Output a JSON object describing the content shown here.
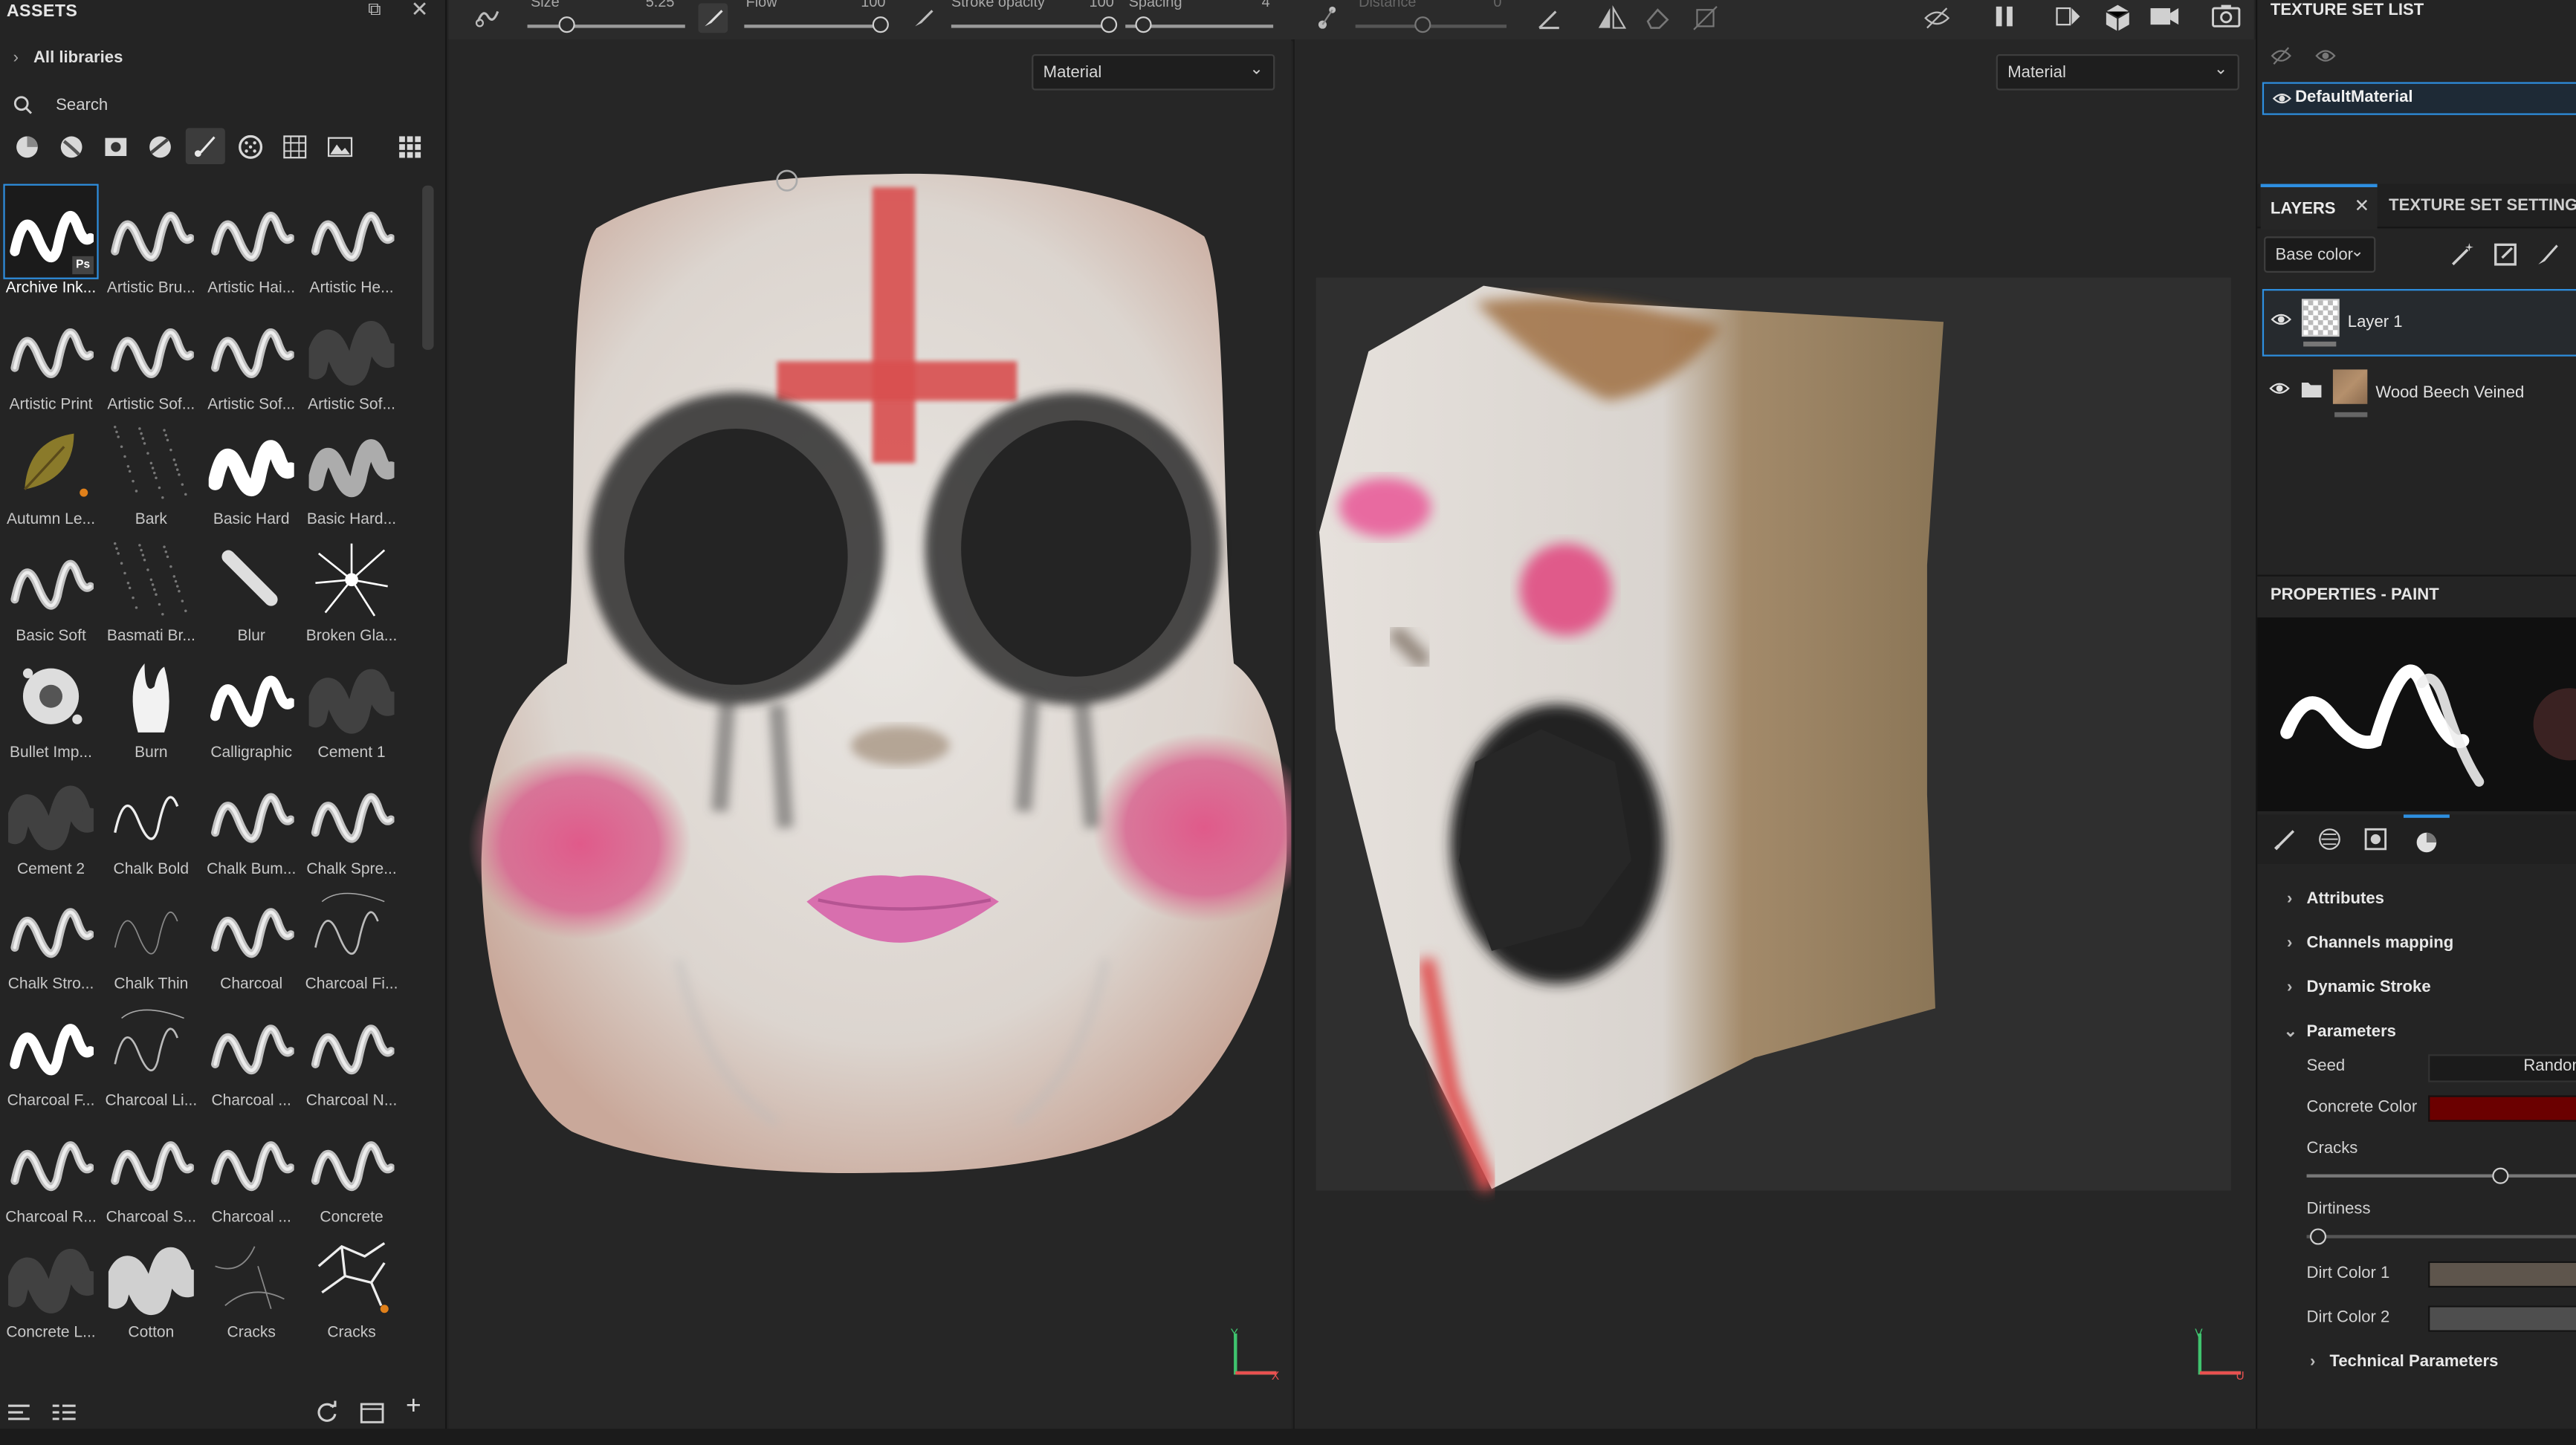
{
  "assets": {
    "title": "ASSETS",
    "breadcrumb": "All libraries",
    "search_placeholder": "Search",
    "brushes": [
      "Archive Ink...",
      "Artistic Bru...",
      "Artistic Hai...",
      "Artistic He...",
      "Artistic Print",
      "Artistic Sof...",
      "Artistic Sof...",
      "Artistic Sof...",
      "Autumn Le...",
      "Bark",
      "Basic Hard",
      "Basic Hard...",
      "Basic Soft",
      "Basmati Br...",
      "Blur",
      "Broken Gla...",
      "Bullet Imp...",
      "Burn",
      "Calligraphic",
      "Cement 1",
      "Cement 2",
      "Chalk Bold",
      "Chalk Bum...",
      "Chalk Spre...",
      "Chalk Stro...",
      "Chalk Thin",
      "Charcoal",
      "Charcoal Fi...",
      "Charcoal F...",
      "Charcoal Li...",
      "Charcoal ...",
      "Charcoal N...",
      "Charcoal R...",
      "Charcoal S...",
      "Charcoal ...",
      "Concrete",
      "Concrete L...",
      "Cotton",
      "Cracks",
      "Cracks"
    ]
  },
  "toolbar": {
    "size_label": "Size",
    "size_value": "5.25",
    "flow_label": "Flow",
    "flow_value": "100",
    "stroke_opacity_label": "Stroke opacity",
    "stroke_opacity_value": "100",
    "spacing_label": "Spacing",
    "spacing_value": "4",
    "distance_label": "Distance",
    "distance_value": "0"
  },
  "viewports": {
    "left_mode": "Material",
    "right_mode": "Material",
    "axis_3d": {
      "up": "Y",
      "right": "X"
    },
    "axis_2d": {
      "up": "V",
      "right": "U"
    }
  },
  "texture_set_list": {
    "title": "TEXTURE SET LIST",
    "items": [
      "DefaultMaterial"
    ]
  },
  "layers": {
    "tab_layers": "LAYERS",
    "tab_texture_settings": "TEXTURE SET SETTING",
    "channel": "Base color",
    "items": [
      {
        "name": "Layer 1"
      },
      {
        "name": "Wood Beech Veined"
      }
    ]
  },
  "properties": {
    "title": "PROPERTIES - PAINT",
    "sections": [
      "Attributes",
      "Channels mapping",
      "Dynamic Stroke",
      "Parameters"
    ],
    "seed_label": "Seed",
    "seed_button": "Random",
    "concrete_color_label": "Concrete Color",
    "concrete_color": "#6b0000",
    "cracks_label": "Cracks",
    "cracks_value": 0.75,
    "dirtiness_label": "Dirtiness",
    "dirtiness_value": 0.0,
    "dirt_color_1_label": "Dirt Color 1",
    "dirt_color_1": "#5e554c",
    "dirt_color_2_label": "Dirt Color 2",
    "dirt_color_2": "#4e4e4e",
    "technical_label": "Technical Parameters"
  },
  "colors": {
    "accent": "#2e8fe0",
    "panel_bg": "#242424",
    "viewport_bg": "#262626"
  }
}
